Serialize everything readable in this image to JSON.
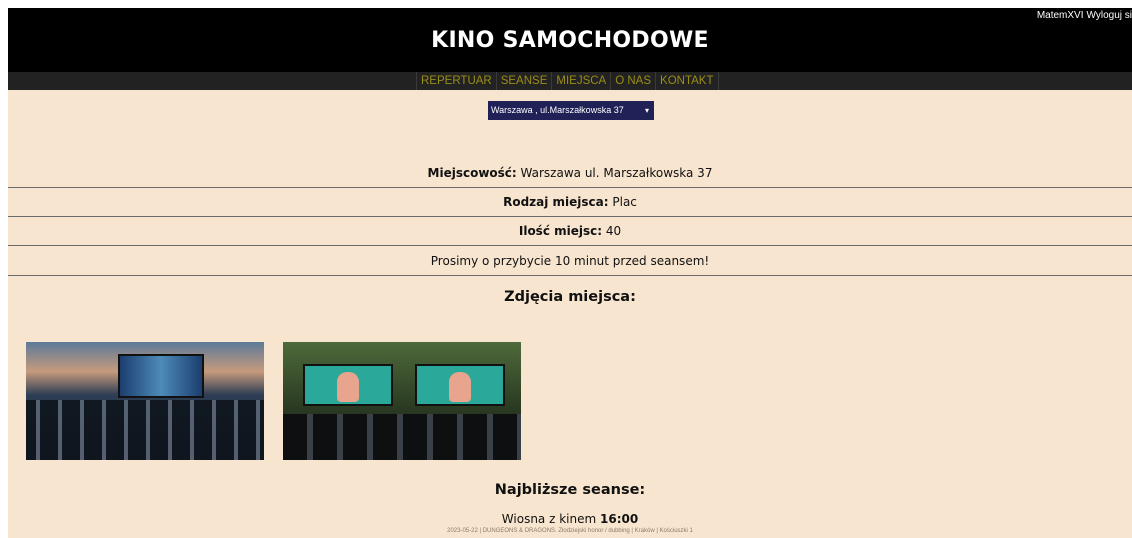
{
  "user": {
    "name": "MatemXVI",
    "logout": "Wyloguj si"
  },
  "header": {
    "title": "KINO SAMOCHODOWE"
  },
  "nav": [
    "REPERTUAR",
    "SEANSE",
    "MIEJSCA",
    "O NAS",
    "KONTAKT"
  ],
  "location_select": {
    "value": "Warszawa , ul.Marszałkowska 37",
    "arrow": "▾"
  },
  "info": {
    "city_label": "Miejscowość:",
    "city_value": " Warszawa ul. Marszałkowska 37",
    "type_label": "Rodzaj miejsca:",
    "type_value": " Plac",
    "seats_label": "Ilość miejsc:",
    "seats_value": " 40",
    "notice": "Prosimy o przybycie 10 minut przed seansem!"
  },
  "photos_title": "Zdjęcia miejsca:",
  "next_title": "Najbliższe seanse:",
  "next_show": {
    "name": "Wiosna z kinem ",
    "time": "16:00"
  },
  "footer": "2023-05-22 | DUNGEONS & DRAGONS. Złodziejski honor / dubbing | Kraków | Kościuszki 1",
  "icons": {
    "dropdown": "chevron-down-icon"
  }
}
